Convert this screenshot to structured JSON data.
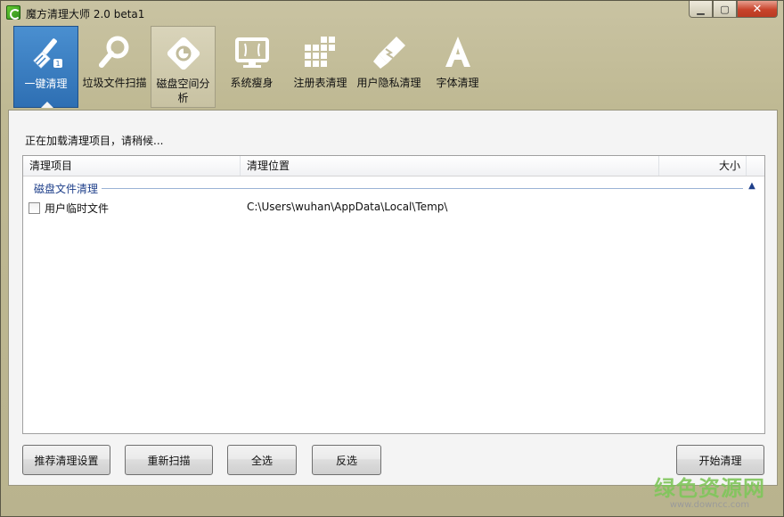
{
  "window": {
    "title": "魔方清理大师 2.0 beta1"
  },
  "window_controls": {
    "minimize": "▁",
    "maximize": "▢",
    "close": "✕"
  },
  "toolbar": {
    "items": [
      {
        "label": "一键清理",
        "icon": "broom-icon",
        "state": "active"
      },
      {
        "label": "垃圾文件扫描",
        "icon": "magnifier-icon",
        "state": "normal"
      },
      {
        "label": "磁盘空间分析",
        "icon": "disk-analysis-icon",
        "state": "hover"
      },
      {
        "label": "系统瘦身",
        "icon": "monitor-icon",
        "state": "normal"
      },
      {
        "label": "注册表清理",
        "icon": "registry-blocks-icon",
        "state": "normal"
      },
      {
        "label": "用户隐私清理",
        "icon": "privacy-shield-icon",
        "state": "normal"
      },
      {
        "label": "字体清理",
        "icon": "font-a-icon",
        "state": "normal"
      }
    ]
  },
  "main": {
    "status": "正在加载清理项目，请稍候...",
    "columns": {
      "item": "清理项目",
      "location": "清理位置",
      "size": "大小"
    },
    "groups": [
      {
        "name": "磁盘文件清理",
        "expanded": true,
        "items": [
          {
            "name": "用户临时文件",
            "path": "C:\\Users\\wuhan\\AppData\\Local\\Temp\\",
            "size": "",
            "checked": false
          }
        ]
      }
    ]
  },
  "buttons": {
    "recommend": "推荐清理设置",
    "rescan": "重新扫描",
    "select_all": "全选",
    "invert": "反选",
    "start": "开始清理"
  },
  "watermark": {
    "cn": "绿色资源网",
    "en": "www.downcc.com"
  },
  "colors": {
    "active_tab": "#3a7fc4",
    "window_bg": "#c4be9c",
    "group_text": "#1e3f8a"
  }
}
